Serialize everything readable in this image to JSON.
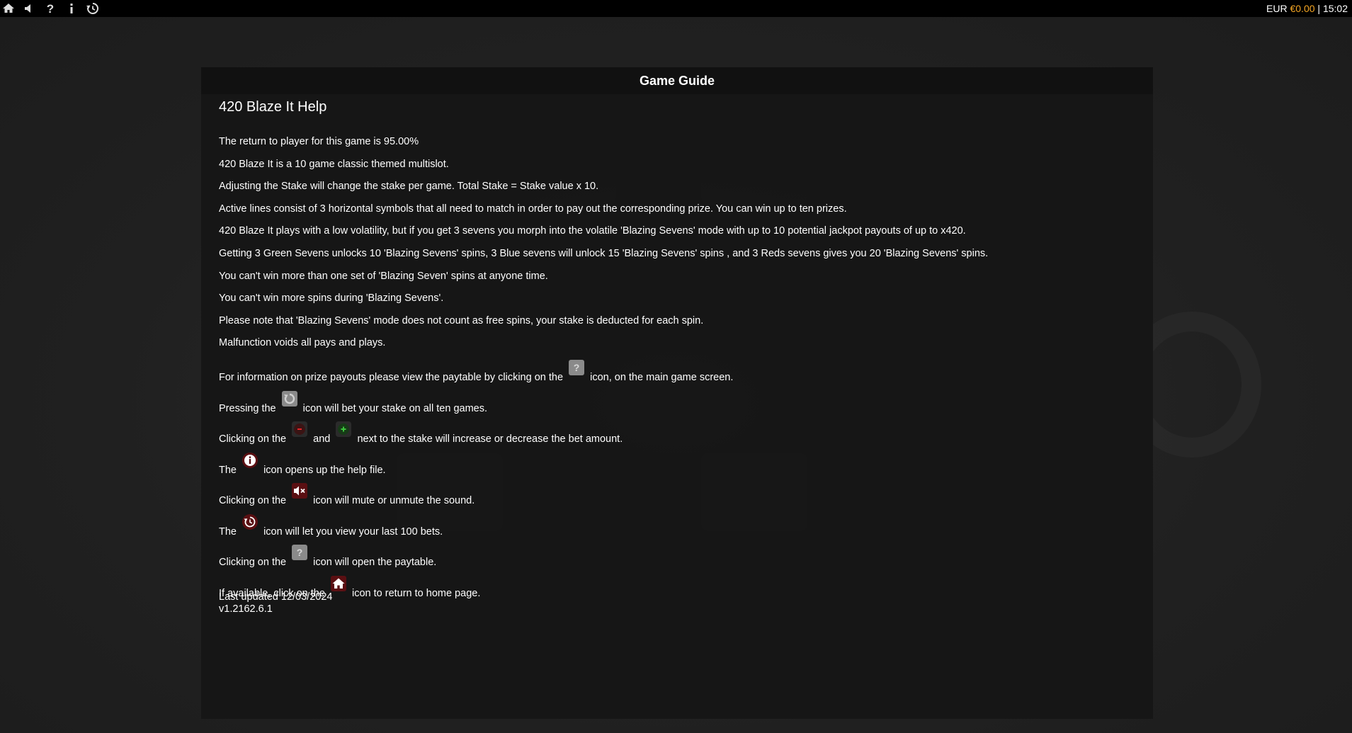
{
  "topbar": {
    "icons": [
      "home-icon",
      "speaker-icon",
      "help-icon",
      "info-icon",
      "history-icon"
    ],
    "currency": "EUR",
    "balance": "€0.00",
    "separator": "|",
    "clock": "15:02"
  },
  "panel": {
    "header": "Game Guide",
    "title": "420 Blaze It Help",
    "paragraphs": [
      "The return to player for this game is 95.00%",
      "420 Blaze It is a 10 game classic themed multislot.",
      "Adjusting the Stake will change the stake per game. Total Stake = Stake value x 10.",
      "Active lines consist of 3 horizontal symbols that all need to match in order to pay out the corresponding prize. You can win up to ten prizes.",
      "420 Blaze It plays with a low volatility, but if you get 3 sevens you morph into the volatile 'Blazing Sevens' mode with up to 10 potential jackpot payouts of up to x420.",
      "Getting 3 Green Sevens unlocks 10 'Blazing Sevens' spins, 3 Blue sevens will unlock 15 'Blazing Sevens' spins , and 3 Reds sevens gives you 20 'Blazing Sevens' spins.",
      "You can't win more than one set of 'Blazing Seven' spins at anyone time.",
      "You can't win more spins during 'Blazing Sevens'.",
      "Please note that 'Blazing Sevens' mode does not count as free spins, your stake is deducted for each spin.",
      "Malfunction voids all pays and plays."
    ],
    "icon_lines": [
      {
        "before": "For information on prize payouts please view the paytable by clicking on the",
        "icon": "paytable-icon",
        "after": "icon, on the main game screen."
      },
      {
        "before": "Pressing the",
        "icon": "spin-icon",
        "after": "icon will bet your stake on all ten games."
      },
      {
        "before": "Clicking on the",
        "icon": "minus-icon",
        "middle": "and",
        "icon2": "plus-icon",
        "after": "next to the stake will increase or decrease the bet amount."
      },
      {
        "before": "The",
        "icon": "info-icon",
        "after": "icon opens up the help file."
      },
      {
        "before": "Clicking on the",
        "icon": "mute-icon",
        "after": "icon will mute or unmute the sound."
      },
      {
        "before": "The",
        "icon": "history-icon",
        "after": "icon will let you view your last 100 bets."
      },
      {
        "before": "Clicking on the",
        "icon": "paytable-icon",
        "after": "icon will open the paytable."
      },
      {
        "before": "If available, click on the",
        "icon": "home-icon",
        "after": "icon to return to home page."
      }
    ],
    "last_updated": "Last updated 12/03/2024",
    "version": "v1.2162.6.1"
  },
  "colors": {
    "topbar_bg": "#000000",
    "balance": "#f5a623",
    "panel_bg": "#161616",
    "header_bg": "#111111",
    "text": "#ffffff",
    "minus_accent": "#e0262a",
    "plus_accent": "#3cc43c",
    "icon_dark_red": "#5a0f12"
  }
}
